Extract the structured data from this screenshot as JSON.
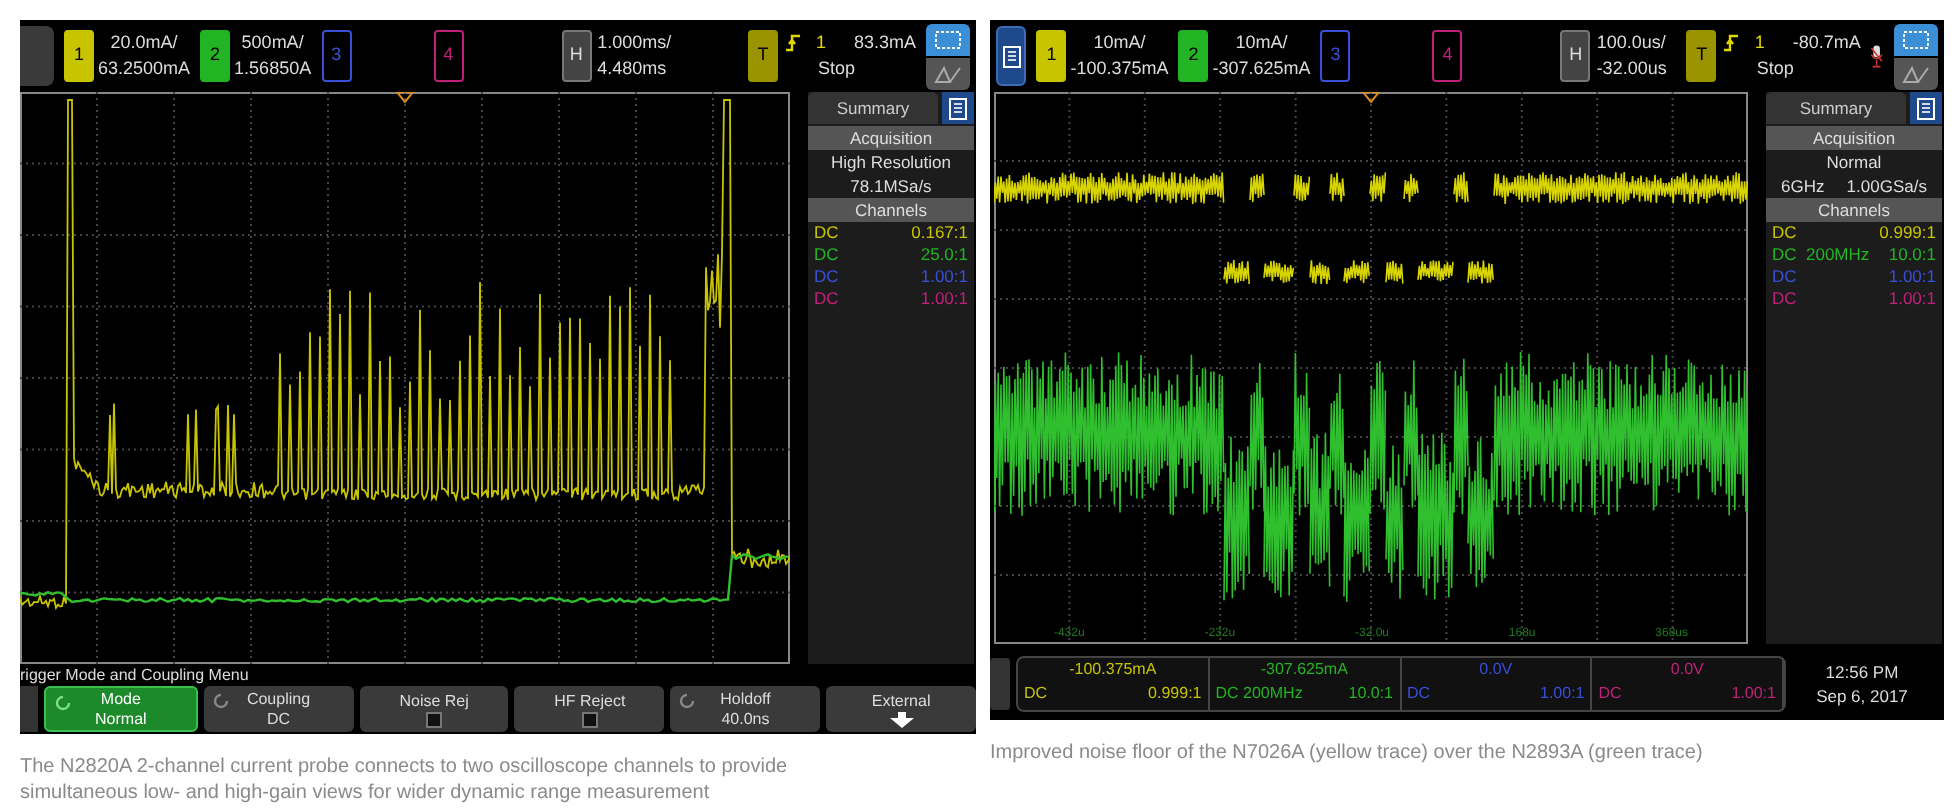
{
  "figures": [
    {
      "scope": {
        "menu_button": {
          "kind": "plain"
        },
        "channels": [
          {
            "number": "1",
            "on": true,
            "color": "#c8c400",
            "scale": "20.0mA/",
            "offset": "63.2500mA"
          },
          {
            "number": "2",
            "on": true,
            "color": "#22b422",
            "scale": "500mA/",
            "offset": "1.56850A"
          },
          {
            "number": "3",
            "on": false,
            "color": "#3a4fd8"
          },
          {
            "number": "4",
            "on": false,
            "color": "#c0207a"
          }
        ],
        "timebase": {
          "label": "H",
          "scale": "1.000ms/",
          "delay": "4.480ms"
        },
        "trigger": {
          "label": "T",
          "source": "1",
          "level": "83.3mA",
          "status": "Stop"
        },
        "microphone": false,
        "summary": {
          "tab": "Summary",
          "acquisition_title": "Acquisition",
          "acquisition": [
            [
              "High Resolution"
            ],
            [
              "78.1MSa/s"
            ]
          ],
          "channels_title": "Channels",
          "channels": [
            {
              "coupling": "DC",
              "ratio": "0.167:1",
              "color": "#c8c400"
            },
            {
              "coupling": "DC",
              "ratio": "25.0:1",
              "color": "#22b422"
            },
            {
              "coupling": "DC",
              "ratio": "1.00:1",
              "color": "#3a4fd8"
            },
            {
              "coupling": "DC",
              "ratio": "1.00:1",
              "color": "#c0207a"
            }
          ]
        },
        "menu": {
          "title": "rigger Mode and Coupling Menu",
          "softkeys": [
            {
              "kind": "value",
              "label": "Mode",
              "value": "Normal",
              "selected": true
            },
            {
              "kind": "value",
              "label": "Coupling",
              "value": "DC",
              "selected": false
            },
            {
              "kind": "checkbox",
              "label": "Noise Rej",
              "checked": false,
              "selected": false
            },
            {
              "kind": "checkbox",
              "label": "HF Reject",
              "checked": false,
              "selected": false
            },
            {
              "kind": "value",
              "label": "Holdoff",
              "value": "40.0ns",
              "selected": false
            },
            {
              "kind": "arrow",
              "label": "External",
              "selected": false
            }
          ]
        }
      },
      "caption": "The N2820A 2-channel current probe connects to two oscilloscope channels to provide simultaneous low- and high-gain views for wider dynamic range measurement"
    },
    {
      "scope": {
        "menu_button": {
          "kind": "blue"
        },
        "channels": [
          {
            "number": "1",
            "on": true,
            "color": "#c8c400",
            "scale": "10mA/",
            "offset": "-100.375mA"
          },
          {
            "number": "2",
            "on": true,
            "color": "#22b422",
            "scale": "10mA/",
            "offset": "-307.625mA"
          },
          {
            "number": "3",
            "on": false,
            "color": "#3a4fd8"
          },
          {
            "number": "4",
            "on": false,
            "color": "#c0207a"
          }
        ],
        "timebase": {
          "label": "H",
          "scale": "100.0us/",
          "delay": "-32.00us"
        },
        "trigger": {
          "label": "T",
          "source": "1",
          "level": "-80.7mA",
          "status": "Stop"
        },
        "microphone": true,
        "grid_labels": [
          "-432u",
          "-232u",
          "-32.0u",
          "168u",
          "368us"
        ],
        "summary": {
          "tab": "Summary",
          "acquisition_title": "Acquisition",
          "acquisition": [
            [
              "Normal"
            ],
            [
              "6GHz",
              "1.00GSa/s"
            ]
          ],
          "channels_title": "Channels",
          "channels": [
            {
              "coupling": "DC",
              "ratio": "0.999:1",
              "color": "#c8c400"
            },
            {
              "coupling": "DC  200MHz",
              "ratio": "10.0:1",
              "color": "#22b422"
            },
            {
              "coupling": "DC",
              "ratio": "1.00:1",
              "color": "#3a4fd8"
            },
            {
              "coupling": "DC",
              "ratio": "1.00:1",
              "color": "#c0207a"
            }
          ]
        },
        "readouts": [
          {
            "reading": "-100.375mA",
            "coupling": "DC",
            "ratio": "0.999:1",
            "color": "#c8c400"
          },
          {
            "reading": "-307.625mA",
            "coupling": "DC 200MHz",
            "ratio": "10.0:1",
            "color": "#22b422"
          },
          {
            "reading": "0.0V",
            "coupling": "DC",
            "ratio": "1.00:1",
            "color": "#3a4fd8"
          },
          {
            "reading": "0.0V",
            "coupling": "DC",
            "ratio": "1.00:1",
            "color": "#c0207a"
          }
        ],
        "time": "12:56 PM",
        "date": "Sep 6, 2017"
      },
      "caption": "Improved noise floor of the N7026A (yellow trace) over the N2893A (green trace)"
    }
  ]
}
